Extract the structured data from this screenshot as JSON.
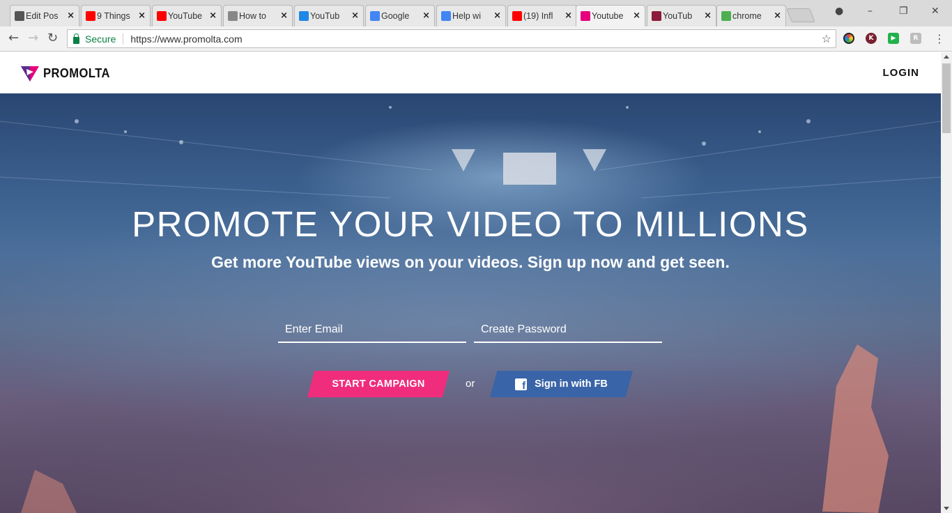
{
  "browser": {
    "tabs": [
      {
        "title": "Edit Pos",
        "favicon": "graduation-cap-icon",
        "color": "#555555"
      },
      {
        "title": "9 Things",
        "favicon": "youtube-icon",
        "color": "#ff0000"
      },
      {
        "title": "YouTube",
        "favicon": "youtube-icon",
        "color": "#ff0000"
      },
      {
        "title": "How to",
        "favicon": "document-icon",
        "color": "#888888"
      },
      {
        "title": "YouTub",
        "favicon": "puzzle-x-icon",
        "color": "#1e88e5"
      },
      {
        "title": "Google",
        "favicon": "google-docs-icon",
        "color": "#4285f4"
      },
      {
        "title": "Help wi",
        "favicon": "google-docs-icon",
        "color": "#4285f4"
      },
      {
        "title": "(19) Infl",
        "favicon": "youtube-icon",
        "color": "#ff0000"
      },
      {
        "title": "Youtube",
        "favicon": "promolta-icon",
        "color": "#e6007e"
      },
      {
        "title": "YouTub",
        "favicon": "video-icon",
        "color": "#8b1a3a"
      },
      {
        "title": "chrome",
        "favicon": "chrome-icon",
        "color": "#4caf50"
      }
    ],
    "active_tab_index": 8,
    "secure_label": "Secure",
    "url": "https://www.promolta.com",
    "extensions": [
      "color-picker-icon",
      "k-extension-icon",
      "green-square-icon",
      "grey-extension-icon"
    ]
  },
  "site": {
    "brand": "PROMOLTA",
    "login_label": "LOGIN",
    "headline": "PROMOTE YOUR VIDEO TO MILLIONS",
    "subheadline": "Get more YouTube views on your videos. Sign up now and get seen.",
    "email_placeholder": "Enter Email",
    "password_placeholder": "Create Password",
    "start_button": "START CAMPAIGN",
    "or_text": "or",
    "fb_button": "Sign in with FB",
    "colors": {
      "accent_pink": "#f02d7d",
      "facebook_blue": "#3a64a8"
    }
  }
}
